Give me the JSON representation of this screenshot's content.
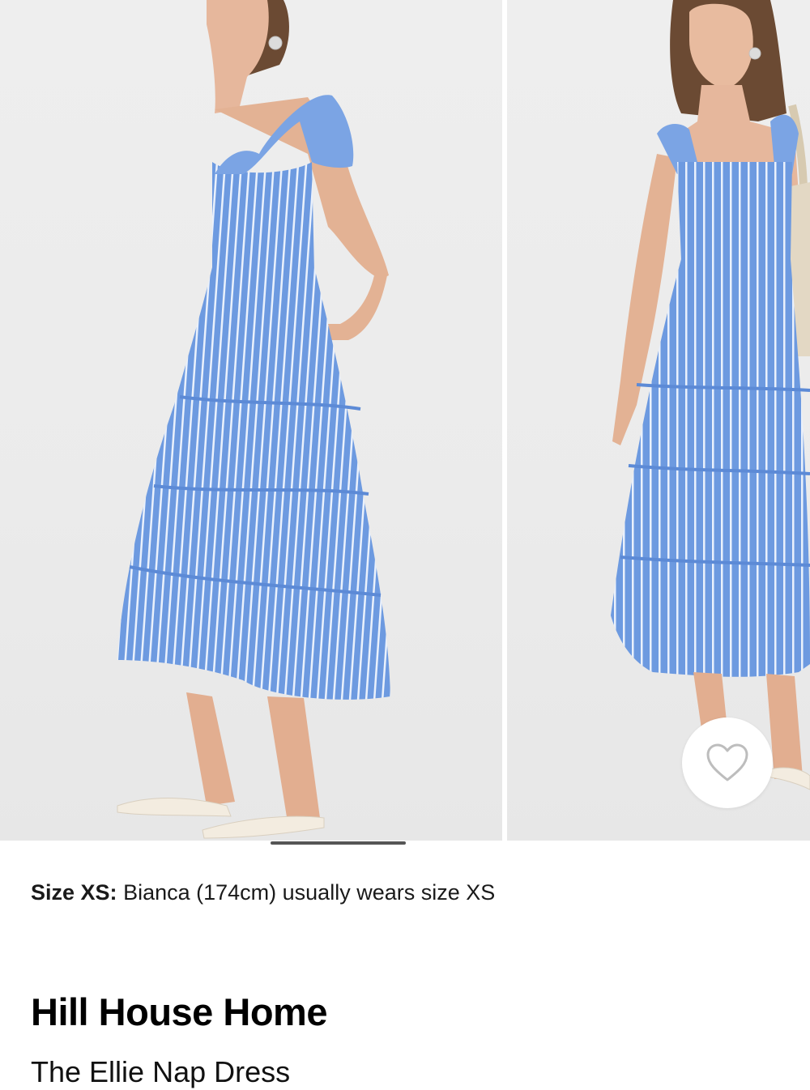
{
  "product": {
    "brand": "Hill House Home",
    "name": "The Ellie Nap Dress",
    "size_note": {
      "label": "Size XS:",
      "text": "Bianca (174cm) usually wears size XS"
    }
  },
  "gallery": {
    "images": [
      {
        "alt": "Model in blue striped tiered midi dress, side view"
      },
      {
        "alt": "Model in blue striped tiered midi dress, front view"
      }
    ],
    "favorite_icon": "heart-outline-icon"
  },
  "colors": {
    "dress_blue": "#6d9ae0",
    "stripe": "#eaf1fc",
    "indicator": "#555555"
  }
}
